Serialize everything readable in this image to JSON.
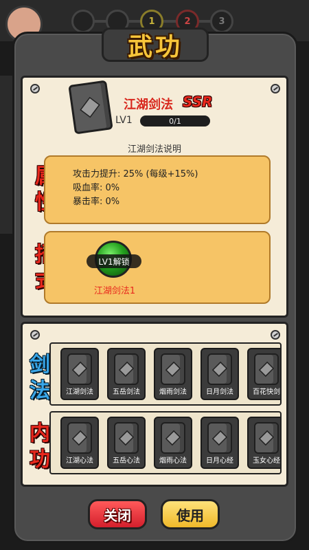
{
  "background": {
    "stages": [
      "1",
      "2",
      "3"
    ]
  },
  "dialog": {
    "title": "武功"
  },
  "skill": {
    "name": "江湖剑法",
    "rank": "SSR",
    "level_label": "LV1",
    "progress_text": "0/1",
    "progress_fraction": 0,
    "description": "江湖剑法说明"
  },
  "attributes": {
    "label": "属性",
    "lines": [
      "攻击力提升: 25% (每级+15%)",
      "吸血率: 0%",
      "暴击率: 0%"
    ]
  },
  "moves": {
    "label": "招式",
    "items": [
      {
        "unlock": "LV1解锁",
        "name": "江湖剑法1"
      }
    ]
  },
  "sword_row": {
    "label": "剑法",
    "cards": [
      "江湖剑法",
      "五岳剑法",
      "烟雨剑法",
      "日月剑法",
      "百花快剑"
    ]
  },
  "inner_row": {
    "label": "内功",
    "cards": [
      "江湖心法",
      "五岳心法",
      "烟雨心法",
      "日月心经",
      "玉女心经"
    ]
  },
  "buttons": {
    "close": "关闭",
    "use": "使用"
  },
  "colors": {
    "title": "#f7c53a",
    "accent_red": "#e8281d",
    "accent_blue": "#39a6e8",
    "parchment": "#f5ecd8",
    "info_box": "#f6c466",
    "close_button": "#d41f2c",
    "use_button": "#f0b92a"
  }
}
